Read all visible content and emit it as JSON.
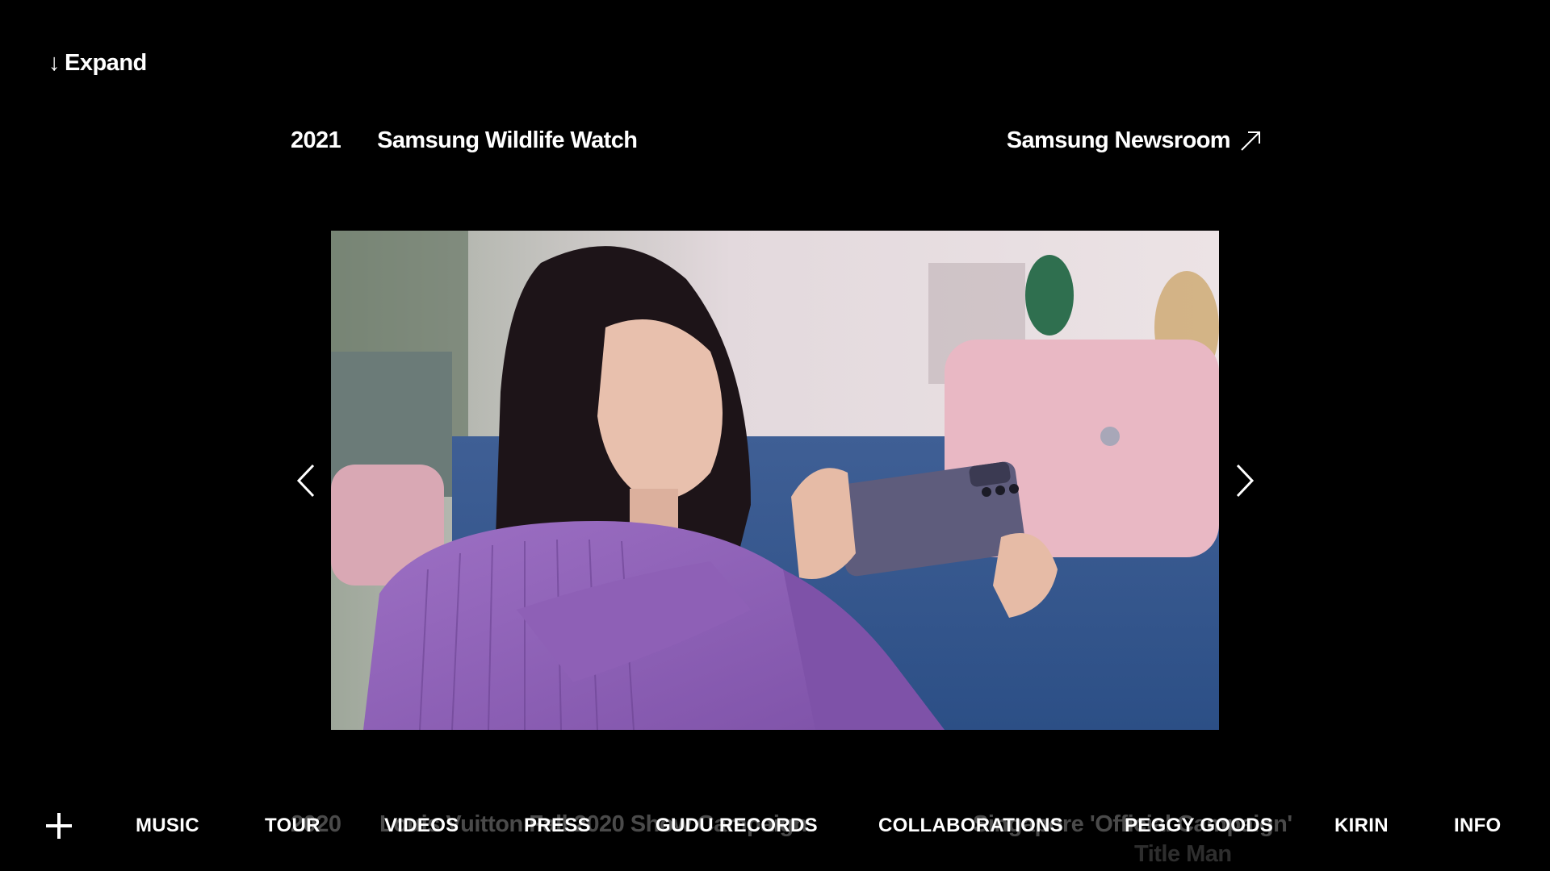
{
  "expand": {
    "label": "Expand",
    "icon": "arrow-down-icon"
  },
  "entry": {
    "year": "2021",
    "title": "Samsung Wildlife Watch",
    "link_label": "Samsung Newsroom",
    "link_icon": "arrow-up-right-icon"
  },
  "slide": {
    "alt": "Woman in purple shirt photographing with a Samsung phone on a blue sofa"
  },
  "carousel": {
    "prev_icon": "chevron-left-icon",
    "next_icon": "chevron-right-icon"
  },
  "ghost": {
    "year": "2020",
    "title": "Louis Vuitton Fall 2020 Show Campaign",
    "right": "Singapore 'Official Campaign'",
    "sub": "Title Man"
  },
  "nav": {
    "plus_icon": "plus-icon",
    "items": [
      "MUSIC",
      "TOUR",
      "VIDEOS",
      "PRESS",
      "GUDU RECORDS",
      "COLLABORATIONS",
      "PEGGY GOODS",
      "KIRIN",
      "INFO"
    ]
  },
  "colors": {
    "background": "#000000",
    "text": "#ffffff",
    "ghost_text": "#4a4a4a"
  }
}
